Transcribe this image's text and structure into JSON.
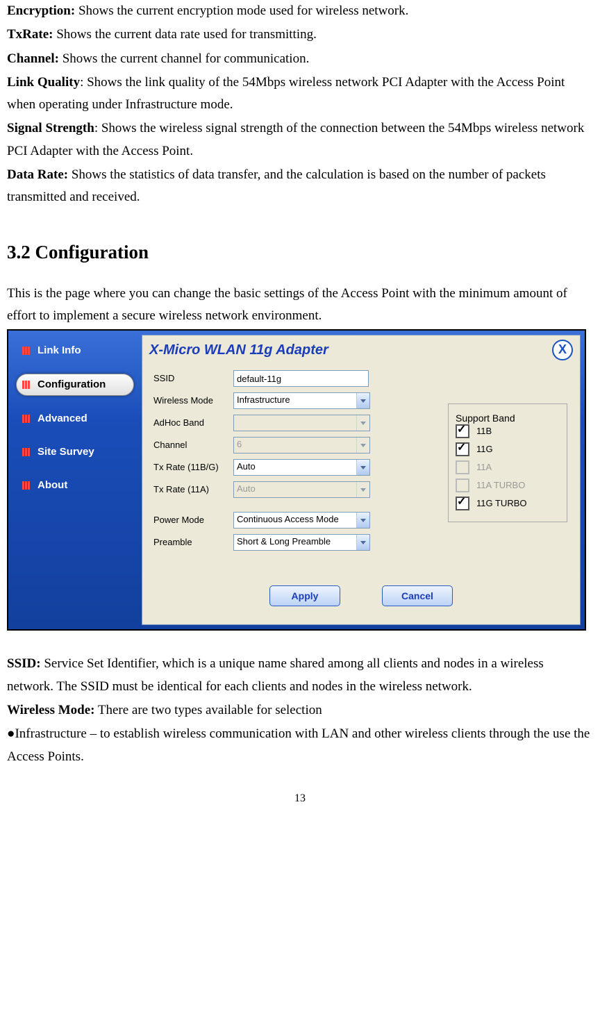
{
  "definitions_top": [
    {
      "term": "Encryption:",
      "desc": " Shows the current encryption mode used for wireless network."
    },
    {
      "term": "TxRate:",
      "desc": " Shows the current data rate used for transmitting."
    },
    {
      "term": "Channel:",
      "desc": " Shows the current channel for communication."
    },
    {
      "term": "Link Quality",
      "desc": ": Shows the link quality of the 54Mbps wireless network PCI Adapter with the Access Point when operating under Infrastructure mode."
    },
    {
      "term": "Signal Strength",
      "desc": ": Shows the wireless signal strength of the connection between the 54Mbps wireless network PCI Adapter with the Access Point."
    },
    {
      "term": "Data Rate:",
      "desc": " Shows the statistics of data transfer, and the calculation is based on the number of packets transmitted and received."
    }
  ],
  "section_heading": "3.2 Configuration",
  "section_intro": "This is the page where you can change the basic settings of the Access Point with the minimum amount of effort to implement a secure wireless network environment.",
  "app": {
    "title": "X-Micro WLAN 11g Adapter",
    "nav": [
      "Link Info",
      "Configuration",
      "Advanced",
      "Site Survey",
      "About"
    ],
    "nav_active_index": 1,
    "fields": {
      "ssid": {
        "label": "SSID",
        "value": "default-11g"
      },
      "wireless_mode": {
        "label": "Wireless Mode",
        "value": "Infrastructure",
        "disabled": false
      },
      "adhoc_band": {
        "label": "AdHoc Band",
        "value": "",
        "disabled": true
      },
      "channel": {
        "label": "Channel",
        "value": "6",
        "disabled": true
      },
      "txrate_bg": {
        "label": "Tx Rate (11B/G)",
        "value": "Auto",
        "disabled": false
      },
      "txrate_a": {
        "label": "Tx Rate (11A)",
        "value": "Auto",
        "disabled": true
      },
      "power_mode": {
        "label": "Power Mode",
        "value": "Continuous Access Mode",
        "disabled": false
      },
      "preamble": {
        "label": "Preamble",
        "value": "Short & Long Preamble",
        "disabled": false
      }
    },
    "support_band": {
      "legend": "Support Band",
      "items": [
        {
          "label": "11B",
          "checked": true,
          "disabled": false
        },
        {
          "label": "11G",
          "checked": true,
          "disabled": false
        },
        {
          "label": "11A",
          "checked": false,
          "disabled": true
        },
        {
          "label": "11A TURBO",
          "checked": false,
          "disabled": true
        },
        {
          "label": "11G TURBO",
          "checked": true,
          "disabled": false
        }
      ]
    },
    "buttons": {
      "apply": "Apply",
      "cancel": "Cancel"
    }
  },
  "definitions_bottom": [
    {
      "term": "SSID:",
      "desc": " Service Set Identifier, which is a unique name shared among all clients and nodes in a wireless network. The SSID must be identical for each clients and nodes in the wireless network."
    },
    {
      "term": "Wireless Mode:",
      "desc": " There are two types available for selection"
    }
  ],
  "bullet_line": "●Infrastructure – to establish wireless communication with LAN and other wireless clients through the use the Access Points.",
  "page_number": "13"
}
